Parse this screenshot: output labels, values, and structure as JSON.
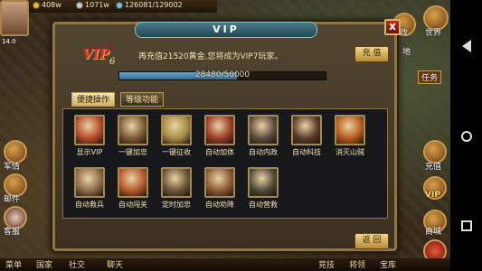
{
  "status": {
    "gold": "408w",
    "silver": "1071w",
    "troops": "126081/129002",
    "player_level": "14.0"
  },
  "left_menu": [
    {
      "label": "军情"
    },
    {
      "label": "邮件"
    },
    {
      "label": "客服"
    }
  ],
  "right_menu": [
    {
      "label": "政"
    },
    {
      "label": "世界"
    },
    {
      "label": "地"
    },
    {
      "label": "任务"
    },
    {
      "label": "充值"
    },
    {
      "label": "VIP"
    },
    {
      "label": "商城"
    }
  ],
  "bottom_bar": [
    {
      "label": "菜单"
    },
    {
      "label": "国家"
    },
    {
      "label": "社交"
    },
    {
      "label": "聊天"
    },
    {
      "label": "竞技"
    },
    {
      "label": "将领"
    },
    {
      "label": "宝库"
    }
  ],
  "dialog": {
    "title": "VIP",
    "close": "x",
    "vip_badge": "VIP",
    "vip_level": "6",
    "recharge_message": "再充值21520黄金,您将成为VIP7玩家。",
    "topup_label": "充 值",
    "progress_text": "28480/50000",
    "progress_fraction": 0.5696,
    "tabs": [
      {
        "label": "便捷操作",
        "active": true
      },
      {
        "label": "等级功能",
        "active": false
      }
    ],
    "features": [
      {
        "label": "显示VIP",
        "color": "#b54a2a"
      },
      {
        "label": "一键加忠",
        "color": "#7a5a34"
      },
      {
        "label": "一键征收",
        "color": "#a78b44"
      },
      {
        "label": "自动加体",
        "color": "#9c3b25"
      },
      {
        "label": "自动内政",
        "color": "#5d4a3d"
      },
      {
        "label": "自动科技",
        "color": "#5a3b2a"
      },
      {
        "label": "消灭山贼",
        "color": "#b85a1c"
      },
      {
        "label": "自动救兵",
        "color": "#8d6a4a"
      },
      {
        "label": "自动闯关",
        "color": "#b3582c"
      },
      {
        "label": "定时加忠",
        "color": "#6b5437"
      },
      {
        "label": "自动劝降",
        "color": "#8a5b34"
      },
      {
        "label": "自动营救",
        "color": "#4e4838"
      }
    ],
    "back_label": "返 回"
  }
}
